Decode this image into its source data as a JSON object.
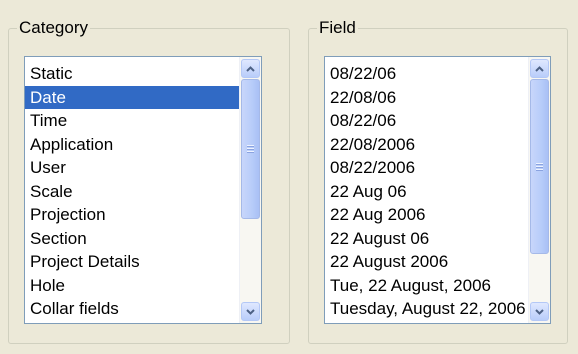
{
  "category": {
    "caption": "Category",
    "items": [
      "Static",
      "Date",
      "Time",
      "Application",
      "User",
      "Scale",
      "Projection",
      "Section",
      "Project Details",
      "Hole",
      "Collar fields"
    ],
    "selected_index": 1,
    "scroll_fraction": 0.0
  },
  "field": {
    "caption": "Field",
    "items": [
      "08/22/06",
      "22/08/06",
      "08/22/06",
      "22/08/2006",
      "08/22/2006",
      "22 Aug 06",
      "22 Aug 2006",
      "22 August 06",
      "22 August 2006",
      "Tue, 22 August, 2006",
      "Tuesday, August 22, 2006"
    ],
    "selected_index": -1,
    "scroll_fraction": 0.0
  },
  "icons": {
    "scroll_up": "chevron-up-icon",
    "scroll_down": "chevron-down-icon"
  },
  "colors": {
    "selection": "#316ac5",
    "window_bg": "#ece9d8",
    "listbox_border": "#7f9db9"
  }
}
